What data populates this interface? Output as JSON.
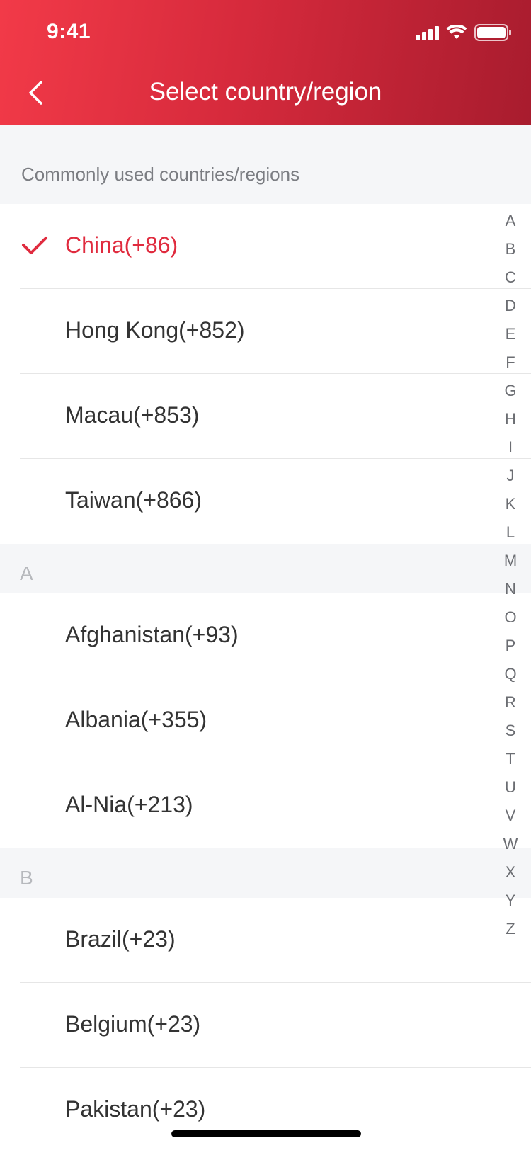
{
  "status_bar": {
    "time": "9:41"
  },
  "header": {
    "title": "Select country/region"
  },
  "common": {
    "heading": "Commonly used countries/regions",
    "items": [
      {
        "label": "China(+86)",
        "selected": true
      },
      {
        "label": "Hong Kong(+852)"
      },
      {
        "label": "Macau(+853)"
      },
      {
        "label": "Taiwan(+866)"
      }
    ]
  },
  "sections": [
    {
      "letter": "A",
      "items": [
        {
          "label": "Afghanistan(+93)"
        },
        {
          "label": "Albania(+355)"
        },
        {
          "label": "Al-Nia(+213)"
        }
      ]
    },
    {
      "letter": "B",
      "items": [
        {
          "label": "Brazil(+23)"
        },
        {
          "label": "Belgium(+23)"
        },
        {
          "label": "Pakistan(+23)"
        }
      ]
    }
  ],
  "index_letters": [
    "A",
    "B",
    "C",
    "D",
    "E",
    "F",
    "G",
    "H",
    "I",
    "J",
    "K",
    "L",
    "M",
    "N",
    "O",
    "P",
    "Q",
    "R",
    "S",
    "T",
    "U",
    "V",
    "W",
    "X",
    "Y",
    "Z"
  ],
  "colors": {
    "accent": "#e02b3e",
    "header_start": "#f23a48",
    "header_end": "#a81c2e"
  }
}
